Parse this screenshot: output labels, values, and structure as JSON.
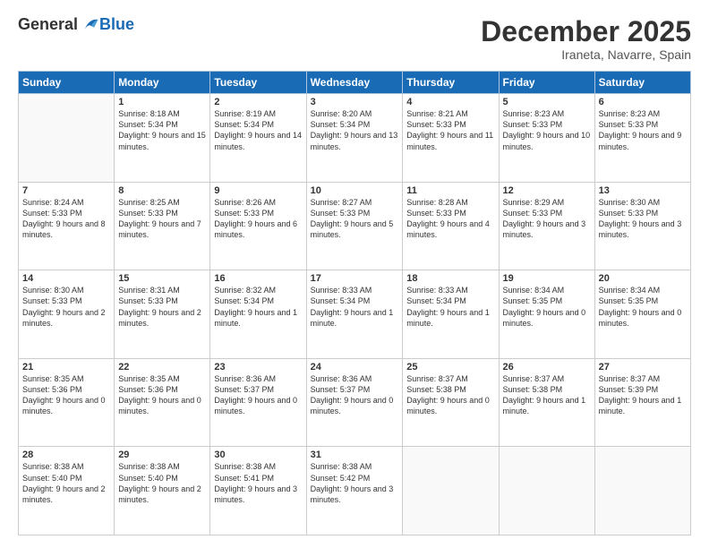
{
  "logo": {
    "general": "General",
    "blue": "Blue"
  },
  "header": {
    "month": "December 2025",
    "location": "Iraneta, Navarre, Spain"
  },
  "days_of_week": [
    "Sunday",
    "Monday",
    "Tuesday",
    "Wednesday",
    "Thursday",
    "Friday",
    "Saturday"
  ],
  "weeks": [
    [
      {
        "day": "",
        "empty": true
      },
      {
        "day": "1",
        "sunrise": "Sunrise: 8:18 AM",
        "sunset": "Sunset: 5:34 PM",
        "daylight": "Daylight: 9 hours and 15 minutes."
      },
      {
        "day": "2",
        "sunrise": "Sunrise: 8:19 AM",
        "sunset": "Sunset: 5:34 PM",
        "daylight": "Daylight: 9 hours and 14 minutes."
      },
      {
        "day": "3",
        "sunrise": "Sunrise: 8:20 AM",
        "sunset": "Sunset: 5:34 PM",
        "daylight": "Daylight: 9 hours and 13 minutes."
      },
      {
        "day": "4",
        "sunrise": "Sunrise: 8:21 AM",
        "sunset": "Sunset: 5:33 PM",
        "daylight": "Daylight: 9 hours and 11 minutes."
      },
      {
        "day": "5",
        "sunrise": "Sunrise: 8:23 AM",
        "sunset": "Sunset: 5:33 PM",
        "daylight": "Daylight: 9 hours and 10 minutes."
      },
      {
        "day": "6",
        "sunrise": "Sunrise: 8:23 AM",
        "sunset": "Sunset: 5:33 PM",
        "daylight": "Daylight: 9 hours and 9 minutes."
      }
    ],
    [
      {
        "day": "7",
        "sunrise": "Sunrise: 8:24 AM",
        "sunset": "Sunset: 5:33 PM",
        "daylight": "Daylight: 9 hours and 8 minutes."
      },
      {
        "day": "8",
        "sunrise": "Sunrise: 8:25 AM",
        "sunset": "Sunset: 5:33 PM",
        "daylight": "Daylight: 9 hours and 7 minutes."
      },
      {
        "day": "9",
        "sunrise": "Sunrise: 8:26 AM",
        "sunset": "Sunset: 5:33 PM",
        "daylight": "Daylight: 9 hours and 6 minutes."
      },
      {
        "day": "10",
        "sunrise": "Sunrise: 8:27 AM",
        "sunset": "Sunset: 5:33 PM",
        "daylight": "Daylight: 9 hours and 5 minutes."
      },
      {
        "day": "11",
        "sunrise": "Sunrise: 8:28 AM",
        "sunset": "Sunset: 5:33 PM",
        "daylight": "Daylight: 9 hours and 4 minutes."
      },
      {
        "day": "12",
        "sunrise": "Sunrise: 8:29 AM",
        "sunset": "Sunset: 5:33 PM",
        "daylight": "Daylight: 9 hours and 3 minutes."
      },
      {
        "day": "13",
        "sunrise": "Sunrise: 8:30 AM",
        "sunset": "Sunset: 5:33 PM",
        "daylight": "Daylight: 9 hours and 3 minutes."
      }
    ],
    [
      {
        "day": "14",
        "sunrise": "Sunrise: 8:30 AM",
        "sunset": "Sunset: 5:33 PM",
        "daylight": "Daylight: 9 hours and 2 minutes."
      },
      {
        "day": "15",
        "sunrise": "Sunrise: 8:31 AM",
        "sunset": "Sunset: 5:33 PM",
        "daylight": "Daylight: 9 hours and 2 minutes."
      },
      {
        "day": "16",
        "sunrise": "Sunrise: 8:32 AM",
        "sunset": "Sunset: 5:34 PM",
        "daylight": "Daylight: 9 hours and 1 minute."
      },
      {
        "day": "17",
        "sunrise": "Sunrise: 8:33 AM",
        "sunset": "Sunset: 5:34 PM",
        "daylight": "Daylight: 9 hours and 1 minute."
      },
      {
        "day": "18",
        "sunrise": "Sunrise: 8:33 AM",
        "sunset": "Sunset: 5:34 PM",
        "daylight": "Daylight: 9 hours and 1 minute."
      },
      {
        "day": "19",
        "sunrise": "Sunrise: 8:34 AM",
        "sunset": "Sunset: 5:35 PM",
        "daylight": "Daylight: 9 hours and 0 minutes."
      },
      {
        "day": "20",
        "sunrise": "Sunrise: 8:34 AM",
        "sunset": "Sunset: 5:35 PM",
        "daylight": "Daylight: 9 hours and 0 minutes."
      }
    ],
    [
      {
        "day": "21",
        "sunrise": "Sunrise: 8:35 AM",
        "sunset": "Sunset: 5:36 PM",
        "daylight": "Daylight: 9 hours and 0 minutes."
      },
      {
        "day": "22",
        "sunrise": "Sunrise: 8:35 AM",
        "sunset": "Sunset: 5:36 PM",
        "daylight": "Daylight: 9 hours and 0 minutes."
      },
      {
        "day": "23",
        "sunrise": "Sunrise: 8:36 AM",
        "sunset": "Sunset: 5:37 PM",
        "daylight": "Daylight: 9 hours and 0 minutes."
      },
      {
        "day": "24",
        "sunrise": "Sunrise: 8:36 AM",
        "sunset": "Sunset: 5:37 PM",
        "daylight": "Daylight: 9 hours and 0 minutes."
      },
      {
        "day": "25",
        "sunrise": "Sunrise: 8:37 AM",
        "sunset": "Sunset: 5:38 PM",
        "daylight": "Daylight: 9 hours and 0 minutes."
      },
      {
        "day": "26",
        "sunrise": "Sunrise: 8:37 AM",
        "sunset": "Sunset: 5:38 PM",
        "daylight": "Daylight: 9 hours and 1 minute."
      },
      {
        "day": "27",
        "sunrise": "Sunrise: 8:37 AM",
        "sunset": "Sunset: 5:39 PM",
        "daylight": "Daylight: 9 hours and 1 minute."
      }
    ],
    [
      {
        "day": "28",
        "sunrise": "Sunrise: 8:38 AM",
        "sunset": "Sunset: 5:40 PM",
        "daylight": "Daylight: 9 hours and 2 minutes."
      },
      {
        "day": "29",
        "sunrise": "Sunrise: 8:38 AM",
        "sunset": "Sunset: 5:40 PM",
        "daylight": "Daylight: 9 hours and 2 minutes."
      },
      {
        "day": "30",
        "sunrise": "Sunrise: 8:38 AM",
        "sunset": "Sunset: 5:41 PM",
        "daylight": "Daylight: 9 hours and 3 minutes."
      },
      {
        "day": "31",
        "sunrise": "Sunrise: 8:38 AM",
        "sunset": "Sunset: 5:42 PM",
        "daylight": "Daylight: 9 hours and 3 minutes."
      },
      {
        "day": "",
        "empty": true
      },
      {
        "day": "",
        "empty": true
      },
      {
        "day": "",
        "empty": true
      }
    ]
  ]
}
